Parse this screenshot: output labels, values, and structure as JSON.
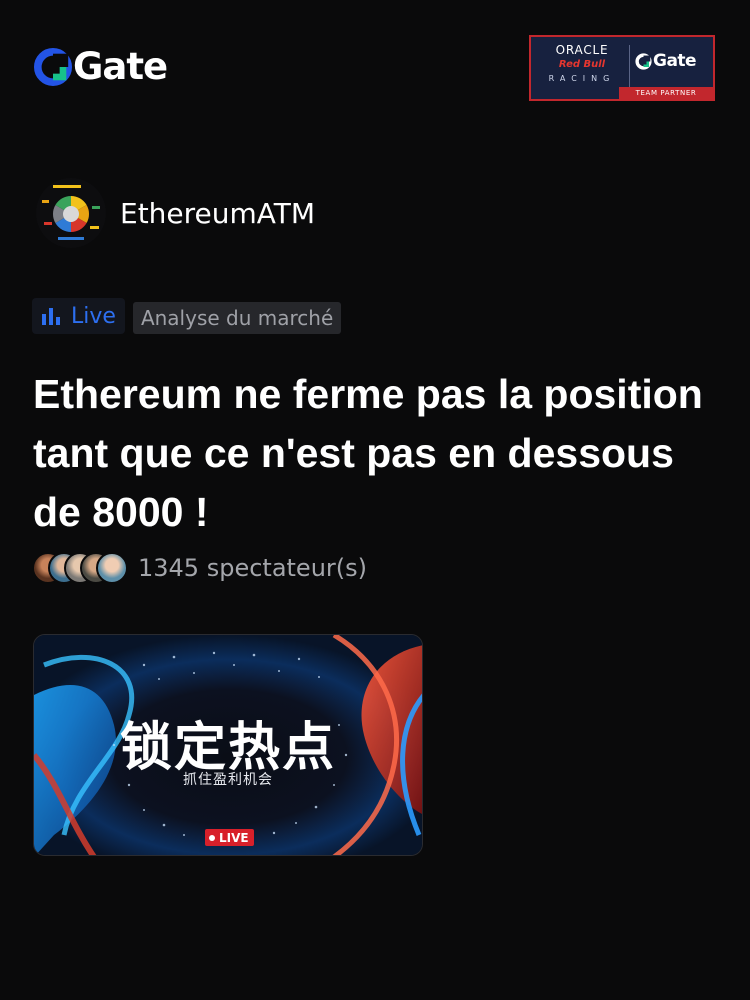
{
  "header": {
    "logo_text": "Gate",
    "brand_color": "#2354e6",
    "accent_color": "#17c28a",
    "partner": {
      "line1": "ORACLE",
      "line2": "Red Bull",
      "line3": "RACING",
      "brand": "Gate",
      "badge": "TEAM PARTNER"
    }
  },
  "streamer": {
    "name": "EthereumATM",
    "avatar_icon": "pie-chart-avatar"
  },
  "tags": {
    "live_label": "Live",
    "live_icon": "bar-chart-icon",
    "live_color": "#2d6ff0",
    "category": "Analyse du marché"
  },
  "title": "Ethereum ne ferme pas la position tant que ce n'est pas en dessous de 8000 !",
  "viewers": {
    "count_text": "1345 spectateur(s)"
  },
  "stream_card": {
    "title": "锁定热点",
    "subtitle": "抓住盈利机会",
    "live_badge": "LIVE",
    "live_color": "#d8202a"
  }
}
